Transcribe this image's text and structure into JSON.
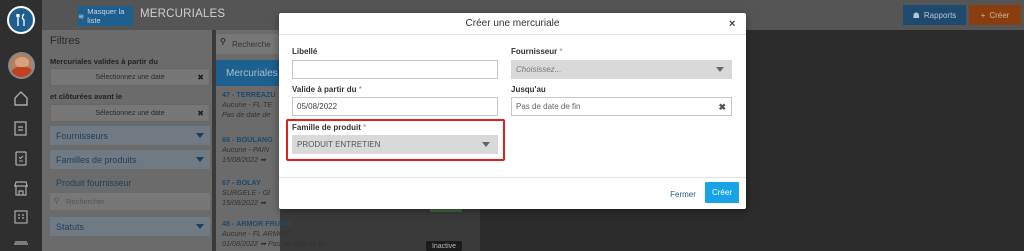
{
  "topbar": {
    "hide_list_label": "Masquer la liste",
    "page_title": "MERCURIALES",
    "reports_label": "Rapports",
    "create_label": "Créer"
  },
  "filters": {
    "title": "Filtres",
    "valid_from_label": "Mercuriales valides à partir du",
    "valid_from_placeholder": "Sélectionnez une date",
    "closed_before_label": "et clôturées avant le",
    "closed_before_placeholder": "Sélectionnez une date",
    "items": [
      "Fournisseurs",
      "Familles de produits",
      "Produit fournisseur"
    ],
    "search_placeholder": "Rechercher",
    "status_label": "Statuts"
  },
  "list": {
    "search_placeholder": "Recherche",
    "header": "Mercuriales",
    "items": [
      {
        "title": "47 - TERREAZU",
        "sub1": "Aucune - FL TE",
        "sub2": "Pas de date de"
      },
      {
        "title": "68 - BOULANG",
        "sub1": "Aucune - PAIN",
        "sub2": "15/08/2022 ➡"
      },
      {
        "title": "67 - BOLAY",
        "sub1": "SURGELE - Gl",
        "sub2": "15/08/2022 ➡"
      }
    ],
    "last_item": {
      "title": "48 - ARMOR FRUITS",
      "sub1": "Aucune - FL ARMOR",
      "sub2": "01/08/2022 ➡ Pas de date de fin",
      "badge": "Inactive"
    }
  },
  "modal": {
    "title": "Créer une mercuriale",
    "close": "×",
    "libelle_label": "Libellé",
    "libelle_value": "",
    "fournisseur_label": "Fournisseur",
    "fournisseur_placeholder": "Choisissez...",
    "valid_from_label": "Valide à partir du",
    "valid_from_value": "05/08/2022",
    "until_label": "Jusqu'au",
    "until_placeholder": "Pas de date de fin",
    "famille_label": "Famille de produit",
    "famille_value": "PRODUIT ENTRETIEN",
    "required_mark": "*",
    "cancel_label": "Fermer",
    "submit_label": "Créer"
  },
  "colors": {
    "primary": "#1d5f8e",
    "accent_orange": "#e8631b",
    "submit_blue": "#18a3e8",
    "highlight_red": "#e02020"
  }
}
